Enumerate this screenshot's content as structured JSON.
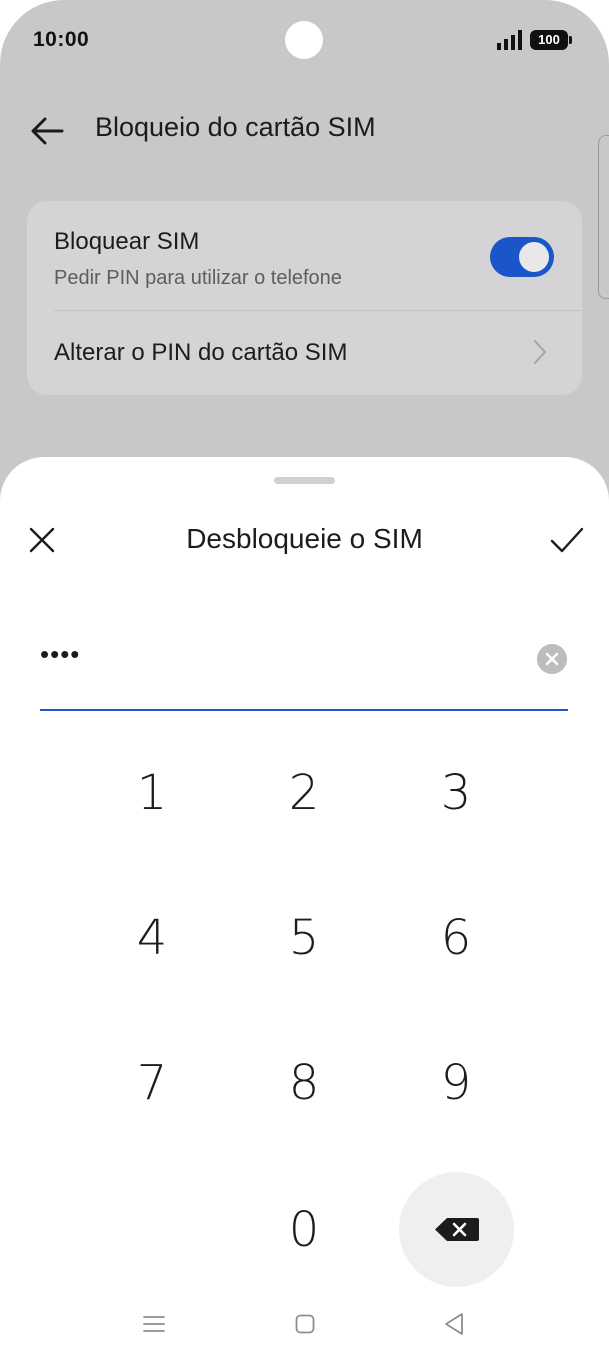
{
  "status_bar": {
    "time": "10:00",
    "battery": "100"
  },
  "header": {
    "title": "Bloqueio do cartão SIM"
  },
  "settings": {
    "lock_sim": {
      "title": "Bloquear SIM",
      "subtitle": "Pedir PIN para utilizar o telefone",
      "enabled": true
    },
    "change_pin": {
      "title": "Alterar o PIN do cartão SIM"
    }
  },
  "dialog": {
    "title": "Desbloqueie o SIM",
    "pin_masked": "••••",
    "keys": [
      "1",
      "2",
      "3",
      "4",
      "5",
      "6",
      "7",
      "8",
      "9",
      "0"
    ]
  },
  "colors": {
    "accent": "#1a56c9",
    "dimmed_bg": "#c8c8ca",
    "card_bg": "#d4d4d6"
  },
  "icons": {
    "back": "arrow-left-icon",
    "chevron": "chevron-right-icon",
    "close": "close-icon",
    "confirm": "check-icon",
    "clear": "clear-circle-icon",
    "backspace": "backspace-icon",
    "nav_menu": "menu-icon",
    "nav_home": "home-icon",
    "nav_back": "triangle-back-icon"
  }
}
